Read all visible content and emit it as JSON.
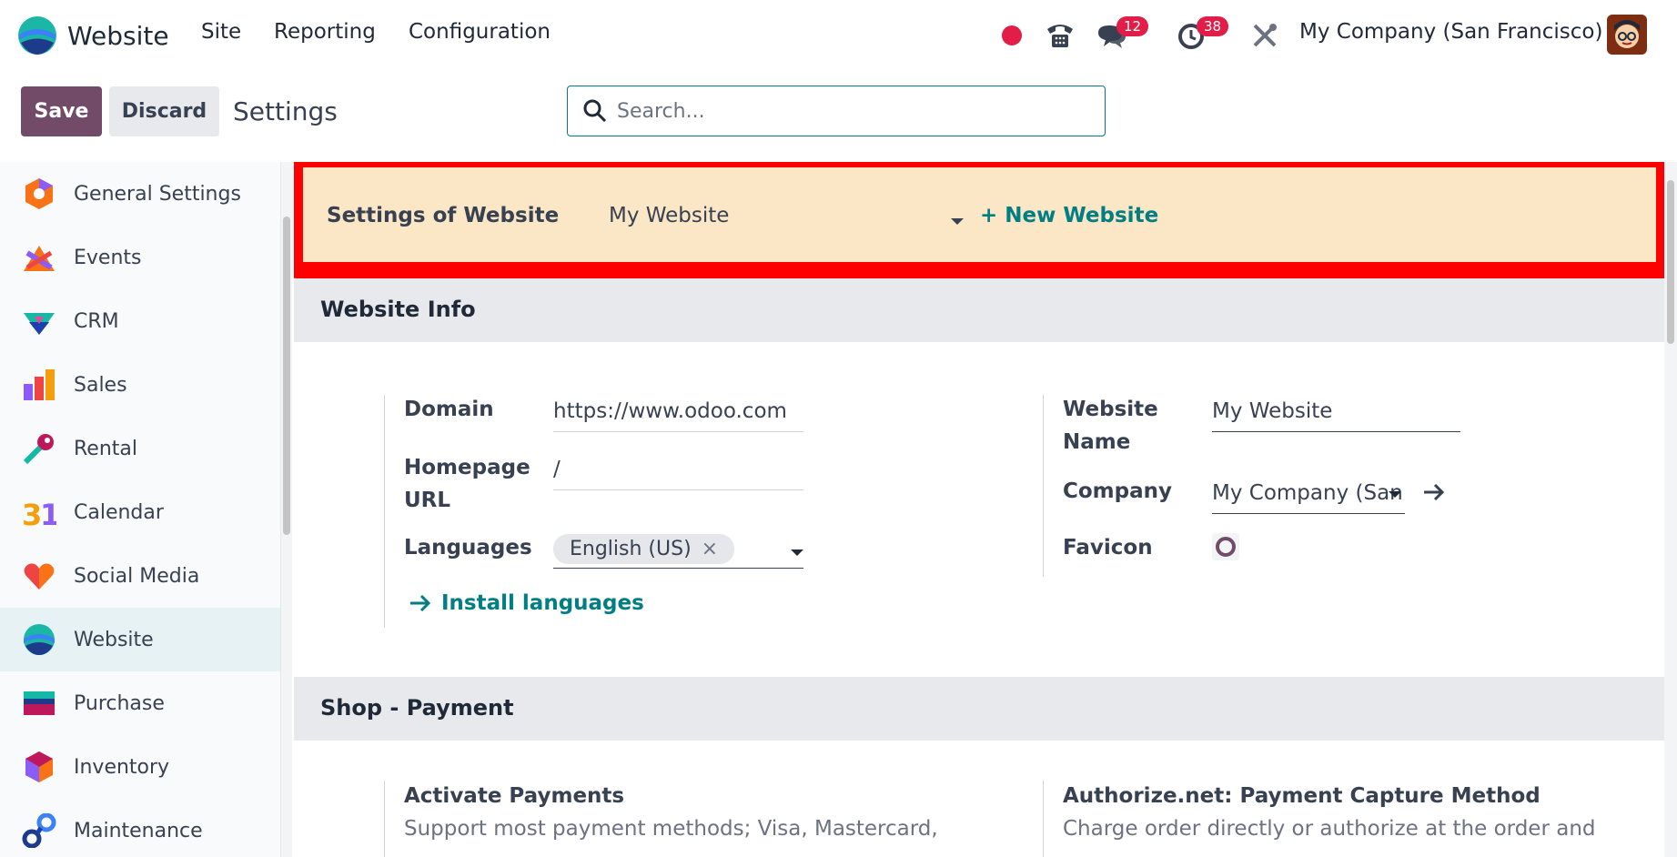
{
  "nav": {
    "app_name": "Website",
    "menu": [
      "Site",
      "Reporting",
      "Configuration"
    ],
    "messages_count": "12",
    "activities_count": "38",
    "company": "My Company (San Francisco)"
  },
  "control": {
    "save_label": "Save",
    "discard_label": "Discard",
    "title": "Settings",
    "search_placeholder": "Search..."
  },
  "sidebar": {
    "items": [
      {
        "label": "General Settings",
        "icon": "general-settings-icon"
      },
      {
        "label": "Events",
        "icon": "events-icon"
      },
      {
        "label": "CRM",
        "icon": "crm-icon"
      },
      {
        "label": "Sales",
        "icon": "sales-icon"
      },
      {
        "label": "Rental",
        "icon": "rental-icon"
      },
      {
        "label": "Calendar",
        "icon": "calendar-icon"
      },
      {
        "label": "Social Media",
        "icon": "social-media-icon"
      },
      {
        "label": "Website",
        "icon": "website-icon",
        "active": true
      },
      {
        "label": "Purchase",
        "icon": "purchase-icon"
      },
      {
        "label": "Inventory",
        "icon": "inventory-icon"
      },
      {
        "label": "Maintenance",
        "icon": "maintenance-icon"
      }
    ]
  },
  "website_selector": {
    "label": "Settings of Website",
    "selected": "My Website",
    "new_label": "+ New Website"
  },
  "website_info": {
    "heading": "Website Info",
    "domain_label": "Domain",
    "domain_value": "https://www.odoo.com",
    "homepage_label_1": "Homepage",
    "homepage_label_2": "URL",
    "homepage_value": "/",
    "languages_label": "Languages",
    "language_tag": "English (US)",
    "install_languages": "Install languages",
    "website_name_label_1": "Website",
    "website_name_label_2": "Name",
    "website_name_value": "My Website",
    "company_label": "Company",
    "company_value": "My Company (San",
    "favicon_label": "Favicon"
  },
  "shop_payment": {
    "heading": "Shop - Payment",
    "activate_title": "Activate Payments",
    "activate_desc": "Support most payment methods; Visa, Mastercard,",
    "authorize_title": "Authorize.net: Payment Capture Method",
    "authorize_desc": "Charge order directly or authorize at the order and"
  },
  "colors": {
    "primary": "#714b67",
    "teal": "#017e84",
    "highlight_border": "#ff0000",
    "highlight_bg": "#fbe6c5",
    "badge": "#e11d48"
  }
}
